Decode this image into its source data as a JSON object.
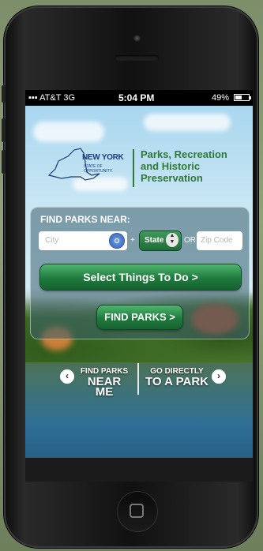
{
  "status_bar": {
    "carrier": "AT&T",
    "network": "3G",
    "time": "5:04 PM",
    "battery": "49%"
  },
  "logo": {
    "state_name": "NEW YORK",
    "state_tagline": "STATE OF OPPORTUNITY.",
    "agency_line1": "Parks, Recreation",
    "agency_line2": "and Historic",
    "agency_line3": "Preservation"
  },
  "search": {
    "title": "FIND PARKS NEAR:",
    "city_placeholder": "City",
    "plus": "+",
    "state_value": "State",
    "or_label": "OR",
    "zip_placeholder": "Zip Code",
    "things_button": "Select Things To Do >",
    "find_button": "FIND PARKS >"
  },
  "bottom_nav": {
    "near_small": "FIND PARKS",
    "near_big": "NEAR ME",
    "direct_small": "GO DIRECTLY",
    "direct_big": "TO A PARK"
  },
  "colors": {
    "brand_green": "#2f7a34",
    "button_green": "#1f7a3d",
    "brand_blue": "#1d3b7a"
  }
}
